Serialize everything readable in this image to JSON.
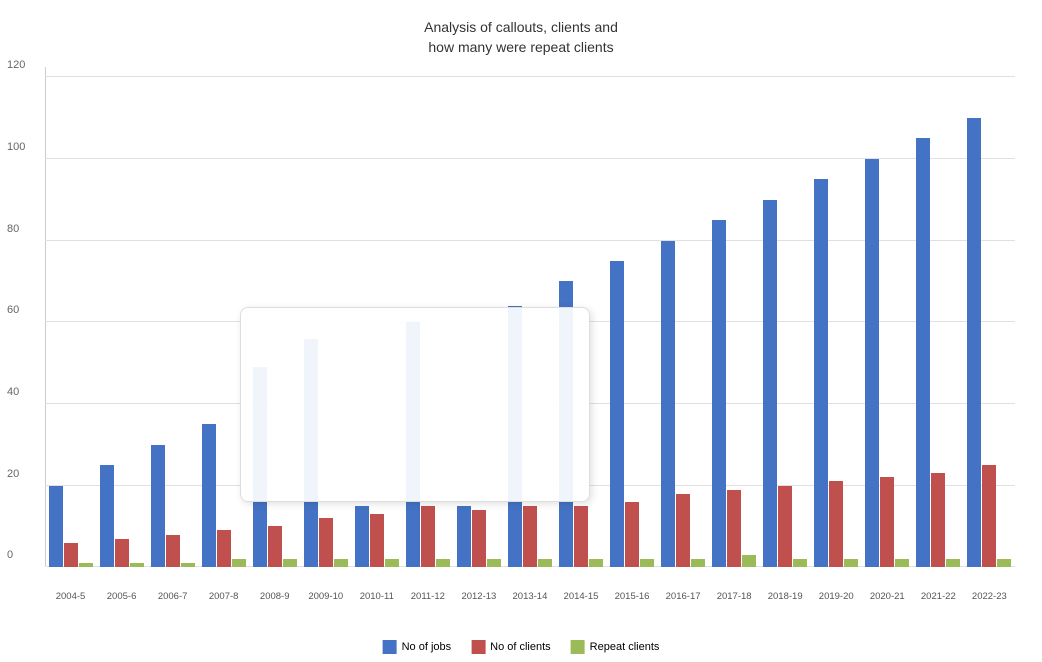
{
  "chart": {
    "title_line1": "Analysis of callouts, clients and",
    "title_line2": "how many were repeat clients",
    "y_axis": {
      "max": 120,
      "labels": [
        0,
        20,
        40,
        60,
        80,
        100,
        120
      ]
    },
    "series": {
      "blue": "No of jobs",
      "red": "No of clients",
      "green": "Repeat clients"
    },
    "years": [
      {
        "label": "2004-5",
        "jobs": 20,
        "clients": 6,
        "repeat": 1
      },
      {
        "label": "2005-6",
        "jobs": 25,
        "clients": 7,
        "repeat": 1
      },
      {
        "label": "2006-7",
        "jobs": 30,
        "clients": 8,
        "repeat": 1
      },
      {
        "label": "2007-8",
        "jobs": 35,
        "clients": 9,
        "repeat": 2
      },
      {
        "label": "2008-9",
        "jobs": 49,
        "clients": 10,
        "repeat": 2
      },
      {
        "label": "2009-10",
        "jobs": 56,
        "clients": 12,
        "repeat": 2
      },
      {
        "label": "2010-11",
        "jobs": 15,
        "clients": 13,
        "repeat": 2
      },
      {
        "label": "2011-12",
        "jobs": 60,
        "clients": 15,
        "repeat": 2
      },
      {
        "label": "2012-13",
        "jobs": 15,
        "clients": 14,
        "repeat": 2
      },
      {
        "label": "2013-14",
        "jobs": 64,
        "clients": 15,
        "repeat": 2
      },
      {
        "label": "2014-15",
        "jobs": 70,
        "clients": 15,
        "repeat": 2
      },
      {
        "label": "2015-16",
        "jobs": 75,
        "clients": 16,
        "repeat": 2
      },
      {
        "label": "2016-17",
        "jobs": 80,
        "clients": 18,
        "repeat": 2
      },
      {
        "label": "2017-18",
        "jobs": 85,
        "clients": 19,
        "repeat": 3
      },
      {
        "label": "2018-19",
        "jobs": 90,
        "clients": 20,
        "repeat": 2
      },
      {
        "label": "2019-20",
        "jobs": 95,
        "clients": 21,
        "repeat": 2
      },
      {
        "label": "2020-21",
        "jobs": 100,
        "clients": 22,
        "repeat": 2
      },
      {
        "label": "2021-22",
        "jobs": 105,
        "clients": 23,
        "repeat": 2
      },
      {
        "label": "2022-23",
        "jobs": 110,
        "clients": 25,
        "repeat": 2
      }
    ]
  },
  "legend": {
    "items": [
      {
        "color": "#4472C4",
        "label": "No of jobs"
      },
      {
        "color": "#C0504D",
        "label": "No of clients"
      },
      {
        "color": "#9BBB59",
        "label": "Repeat clients"
      }
    ]
  }
}
